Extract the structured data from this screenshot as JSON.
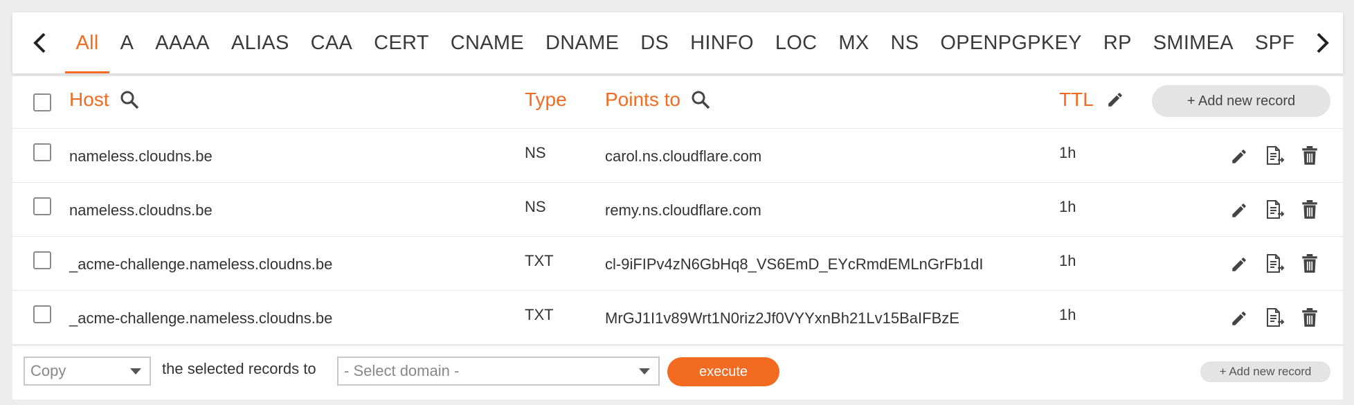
{
  "tabs": {
    "items": [
      "All",
      "A",
      "AAAA",
      "ALIAS",
      "CAA",
      "CERT",
      "CNAME",
      "DNAME",
      "DS",
      "HINFO",
      "LOC",
      "MX",
      "NS",
      "OPENPGPKEY",
      "RP",
      "SMIMEA",
      "SPF"
    ],
    "active": "All"
  },
  "table": {
    "headers": {
      "host": "Host",
      "type": "Type",
      "points_to": "Points to",
      "ttl": "TTL"
    },
    "add_record_label": "+ Add new record",
    "rows": [
      {
        "host": "nameless.cloudns.be",
        "type": "NS",
        "points_to": "carol.ns.cloudflare.com",
        "ttl": "1h"
      },
      {
        "host": "nameless.cloudns.be",
        "type": "NS",
        "points_to": "remy.ns.cloudflare.com",
        "ttl": "1h"
      },
      {
        "host": "_acme-challenge.nameless.cloudns.be",
        "type": "TXT",
        "points_to": "cl-9iFIPv4zN6GbHq8_VS6EmD_EYcRmdEMLnGrFb1dI",
        "ttl": "1h"
      },
      {
        "host": "_acme-challenge.nameless.cloudns.be",
        "type": "TXT",
        "points_to": "MrGJ1I1v89Wrt1N0riz2Jf0VYYxnBh21Lv15BaIFBzE",
        "ttl": "1h"
      }
    ]
  },
  "footer": {
    "action_select": "Copy",
    "label": "the selected records to",
    "domain_select": "- Select domain -",
    "execute_label": "execute",
    "add_record_label": "+ Add new record"
  },
  "colors": {
    "accent": "#f26b21",
    "background": "#ededed"
  }
}
